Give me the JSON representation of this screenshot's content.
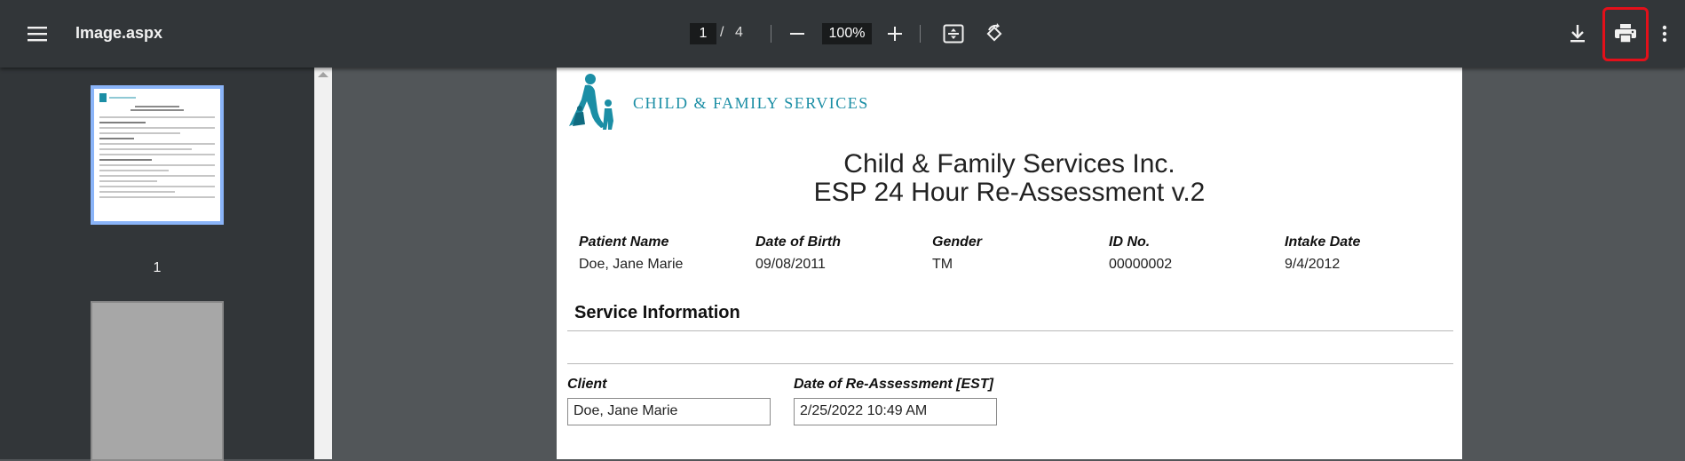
{
  "toolbar": {
    "title": "Image.aspx",
    "current_page": "1",
    "page_separator": "/",
    "total_pages": "4",
    "zoom": "100%",
    "icons": [
      "menu-icon",
      "zoom-out-icon",
      "zoom-in-icon",
      "fit-page-icon",
      "rotate-icon",
      "download-icon",
      "print-icon",
      "more-options-icon"
    ],
    "highlight_color": "#e3101a"
  },
  "sidebar": {
    "thumbnails": [
      {
        "label": "1",
        "selected": true
      },
      {
        "label": "",
        "selected": false
      }
    ]
  },
  "document": {
    "logo_text": "CHILD & FAMILY SERVICES",
    "org_title": "Child & Family Services Inc.",
    "form_title": "ESP 24 Hour Re-Assessment v.2",
    "patient_fields": [
      {
        "label": "Patient Name",
        "value": "Doe, Jane Marie"
      },
      {
        "label": "Date of Birth",
        "value": "09/08/2011"
      },
      {
        "label": "Gender",
        "value": "TM"
      },
      {
        "label": "ID No.",
        "value": "00000002"
      },
      {
        "label": "Intake Date",
        "value": "9/4/2012"
      }
    ],
    "section_title": "Service Information",
    "client_label": "Client",
    "client_value": "Doe, Jane Marie",
    "reassessment_label": "Date of Re-Assessment [EST]",
    "reassessment_value": "2/25/2022 10:49 AM",
    "brand_color": "#1b8ea5"
  }
}
